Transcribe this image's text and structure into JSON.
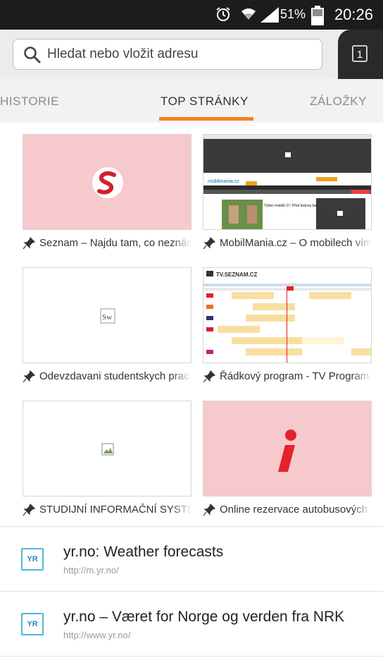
{
  "status_bar": {
    "battery_percent": "51%",
    "time": "20:26",
    "icons": [
      "alarm-icon",
      "wifi-icon",
      "signal-icon",
      "battery-icon"
    ]
  },
  "toolbar": {
    "url_placeholder": "Hledat nebo vložit adresu",
    "tab_count": "1"
  },
  "tabs": {
    "history": "HISTORIE",
    "top_sites": "TOP STRÁNKY",
    "bookmarks": "ZÁLOŽKY",
    "active": "top_sites",
    "accent_color": "#f58220"
  },
  "top_sites": [
    {
      "label": "Seznam – Najdu tam, co neznám"
    },
    {
      "label": "MobilMania.cz – O mobilech vím"
    },
    {
      "label": "Odevzdavani studentskych prací"
    },
    {
      "label": "Řádkový program - TV Program"
    },
    {
      "label": "STUDIJNÍ INFORMAČNÍ SYSTÉM"
    },
    {
      "label": "Online rezervace autobusových"
    }
  ],
  "thumb_text": {
    "mobilmania_logo": "mobilmania.cz",
    "mobilmania_headline": "Týden mobilů 37: Před bránou barcelonského MWC",
    "tvseznam_logo": "TV.SEZNAM.CZ",
    "sw_glyph": "Sw"
  },
  "history": [
    {
      "favicon": "YR",
      "title": "yr.no: Weather forecasts",
      "url": "http://m.yr.no/"
    },
    {
      "favicon": "YR",
      "title": "yr.no – Været for Norge og verden fra NRK",
      "url": "http://www.yr.no/"
    }
  ]
}
